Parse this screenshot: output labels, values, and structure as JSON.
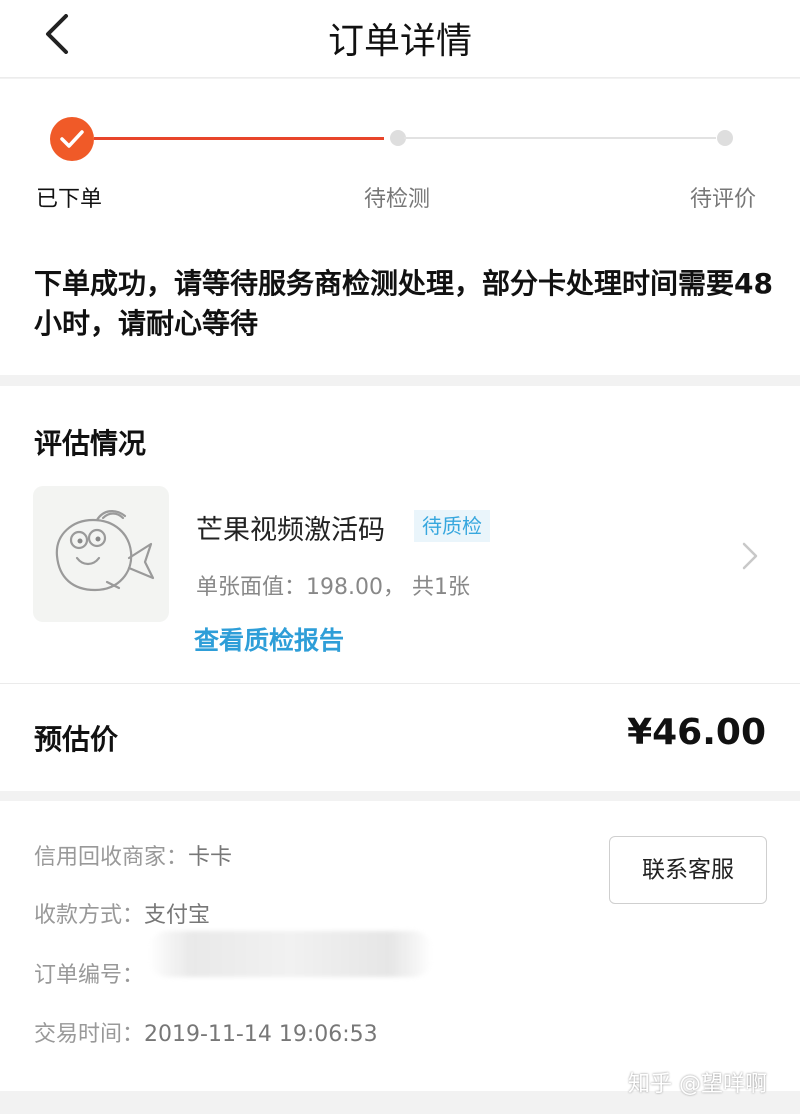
{
  "header": {
    "title": "订单详情",
    "back_icon": "chevron-left-icon"
  },
  "progress": {
    "steps": [
      {
        "label": "已下单",
        "status": "done"
      },
      {
        "label": "待检测",
        "status": "pending"
      },
      {
        "label": "待评价",
        "status": "pending"
      }
    ],
    "notice": "下单成功，请等待服务商检测处理，部分卡处理时间需要48小时，请耐心等待"
  },
  "assessment": {
    "title": "评估情况",
    "product_name": "芒果视频激活码",
    "badge": "待质检",
    "face_value": "单张面值：198.00， 共1张",
    "report_link": "查看质检报告",
    "estimate_label": "预估价",
    "estimate_price": "¥46.00"
  },
  "info": {
    "merchant_label": "信用回收商家：",
    "merchant_value": "卡卡",
    "payment_label": "收款方式：",
    "payment_value": "支付宝",
    "order_no_label": "订单编号：",
    "time_label": "交易时间：",
    "time_value": "2019-11-14 19:06:53",
    "contact_button": "联系客服"
  },
  "watermark": "知乎 @望咩啊",
  "colors": {
    "accent": "#f05a28",
    "link": "#2e9ed8",
    "badge_bg": "#eaf5fb"
  }
}
